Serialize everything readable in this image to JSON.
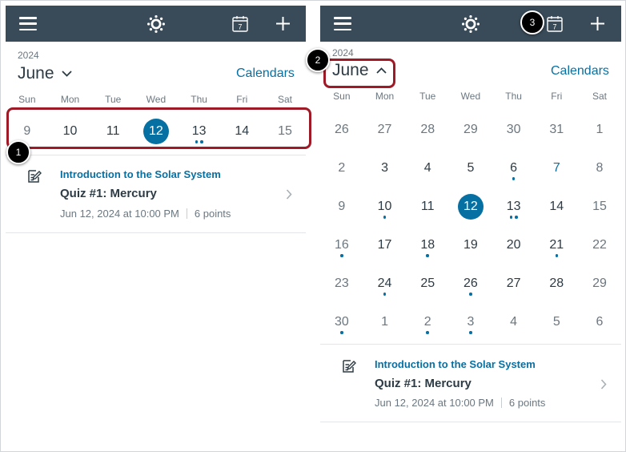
{
  "left_panel": {
    "year": "2024",
    "month": "June",
    "calendars_label": "Calendars",
    "weekdays": [
      "Sun",
      "Mon",
      "Tue",
      "Wed",
      "Thu",
      "Fri",
      "Sat"
    ],
    "week": [
      {
        "n": "9",
        "style": "muted",
        "dots": 0
      },
      {
        "n": "10",
        "style": "regular",
        "dots": 0
      },
      {
        "n": "11",
        "style": "regular",
        "dots": 0
      },
      {
        "n": "12",
        "style": "selected",
        "dots": 0
      },
      {
        "n": "13",
        "style": "regular",
        "dots": 2
      },
      {
        "n": "14",
        "style": "regular",
        "dots": 0
      },
      {
        "n": "15",
        "style": "muted",
        "dots": 0
      }
    ],
    "event": {
      "course": "Introduction to the Solar System",
      "title": "Quiz #1: Mercury",
      "datetime": "Jun 12, 2024 at 10:00 PM",
      "points": "6 points"
    }
  },
  "right_panel": {
    "year": "2024",
    "month": "June",
    "calendars_label": "Calendars",
    "weekdays": [
      "Sun",
      "Mon",
      "Tue",
      "Wed",
      "Thu",
      "Fri",
      "Sat"
    ],
    "weeks": [
      [
        {
          "n": "26",
          "style": "muted",
          "dots": 0
        },
        {
          "n": "27",
          "style": "muted",
          "dots": 0
        },
        {
          "n": "28",
          "style": "muted",
          "dots": 0
        },
        {
          "n": "29",
          "style": "muted",
          "dots": 0
        },
        {
          "n": "30",
          "style": "muted",
          "dots": 0
        },
        {
          "n": "31",
          "style": "muted",
          "dots": 0
        },
        {
          "n": "1",
          "style": "muted",
          "dots": 0
        }
      ],
      [
        {
          "n": "2",
          "style": "muted",
          "dots": 0
        },
        {
          "n": "3",
          "style": "regular",
          "dots": 0
        },
        {
          "n": "4",
          "style": "regular",
          "dots": 0
        },
        {
          "n": "5",
          "style": "regular",
          "dots": 0
        },
        {
          "n": "6",
          "style": "regular",
          "dots": 1
        },
        {
          "n": "7",
          "style": "blue",
          "dots": 0
        },
        {
          "n": "8",
          "style": "muted",
          "dots": 0
        }
      ],
      [
        {
          "n": "9",
          "style": "muted",
          "dots": 0
        },
        {
          "n": "10",
          "style": "regular",
          "dots": 1
        },
        {
          "n": "11",
          "style": "regular",
          "dots": 0
        },
        {
          "n": "12",
          "style": "selected",
          "dots": 0
        },
        {
          "n": "13",
          "style": "regular",
          "dots": 2
        },
        {
          "n": "14",
          "style": "regular",
          "dots": 0
        },
        {
          "n": "15",
          "style": "muted",
          "dots": 0
        }
      ],
      [
        {
          "n": "16",
          "style": "muted",
          "dots": 1
        },
        {
          "n": "17",
          "style": "regular",
          "dots": 0
        },
        {
          "n": "18",
          "style": "regular",
          "dots": 1
        },
        {
          "n": "19",
          "style": "regular",
          "dots": 0
        },
        {
          "n": "20",
          "style": "regular",
          "dots": 0
        },
        {
          "n": "21",
          "style": "regular",
          "dots": 1
        },
        {
          "n": "22",
          "style": "muted",
          "dots": 0
        }
      ],
      [
        {
          "n": "23",
          "style": "muted",
          "dots": 0
        },
        {
          "n": "24",
          "style": "regular",
          "dots": 1
        },
        {
          "n": "25",
          "style": "regular",
          "dots": 0
        },
        {
          "n": "26",
          "style": "regular",
          "dots": 1
        },
        {
          "n": "27",
          "style": "regular",
          "dots": 0
        },
        {
          "n": "28",
          "style": "regular",
          "dots": 0
        },
        {
          "n": "29",
          "style": "muted",
          "dots": 0
        }
      ],
      [
        {
          "n": "30",
          "style": "muted",
          "dots": 1
        },
        {
          "n": "1",
          "style": "muted",
          "dots": 0
        },
        {
          "n": "2",
          "style": "muted",
          "dots": 1
        },
        {
          "n": "3",
          "style": "muted",
          "dots": 1
        },
        {
          "n": "4",
          "style": "muted",
          "dots": 0
        },
        {
          "n": "5",
          "style": "muted",
          "dots": 0
        },
        {
          "n": "6",
          "style": "muted",
          "dots": 0
        }
      ]
    ],
    "event": {
      "course": "Introduction to the Solar System",
      "title": "Quiz #1: Mercury",
      "datetime": "Jun 12, 2024 at 10:00 PM",
      "points": "6 points"
    }
  },
  "topbar": {
    "calendar_icon_day": "7",
    "icons": [
      "hamburger-menu-icon",
      "canvas-logo-icon",
      "calendar-today-icon",
      "add-icon"
    ]
  },
  "callouts": [
    "1",
    "2",
    "3"
  ],
  "colors": {
    "topbar": "#394b58",
    "accent": "#0770a3",
    "highlight": "#9e1a27",
    "text": "#2d3b45",
    "muted": "#6b7780"
  }
}
